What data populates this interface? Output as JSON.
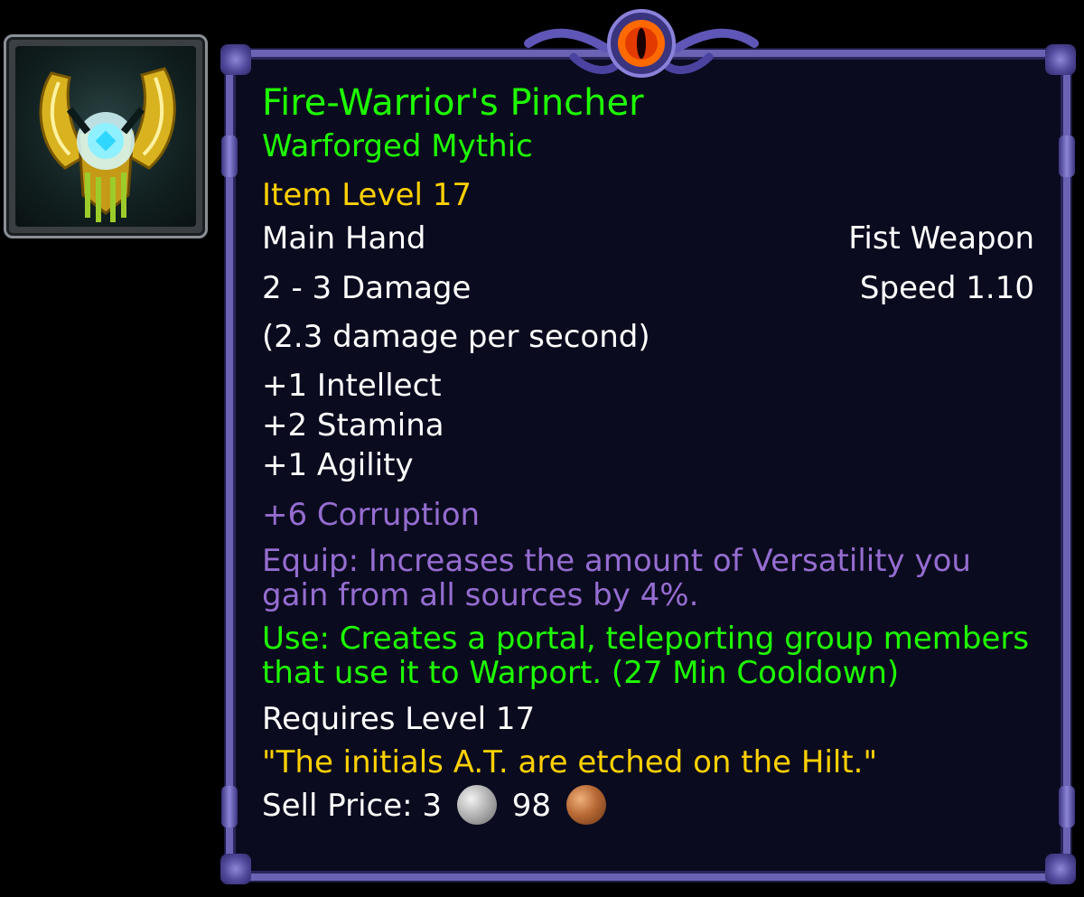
{
  "item": {
    "icon": "gold-winged-gauntlet-icon",
    "name": "Fire-Warrior's Pincher",
    "quality": "Warforged Mythic",
    "item_level": "Item Level 17",
    "slot": "Main Hand",
    "type": "Fist Weapon",
    "damage": "2 - 3 Damage",
    "speed": "Speed 1.10",
    "dps": "(2.3 damage per second)",
    "stats": [
      "+1 Intellect",
      "+2 Stamina",
      "+1 Agility"
    ],
    "corruption": "+6 Corruption",
    "equip": "Equip: Increases the amount of Versatility you gain from all sources by 4%.",
    "use": "Use: Creates a portal, teleporting group members that use it to Warport. (27 Min Cooldown)",
    "requires": "Requires Level 17",
    "flavor": "\"The initials A.T. are etched on the Hilt.\"",
    "sell_label": "Sell Price:",
    "sell_silver": "3",
    "sell_copper": "98"
  },
  "colors": {
    "name": "#1eff00",
    "item_level": "#ffd100",
    "corruption": "#956dd1",
    "frame": "#6a63b4",
    "background": "#0b0b1f"
  }
}
